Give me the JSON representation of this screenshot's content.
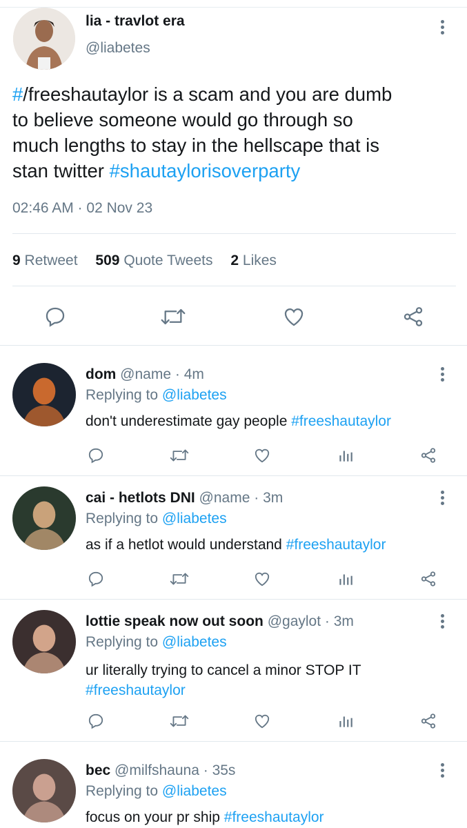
{
  "main_tweet": {
    "display_name": "lia - travlot era",
    "handle": "@liabetes",
    "text_parts": {
      "hash_char": "#",
      "line1_rest": "/freeshautaylor is a scam and you are dumb",
      "line2": "to believe someone would go through so",
      "line3": "much lengths to stay in the hellscape that is",
      "line4_pre": "stan twitter ",
      "line4_tag": "#shautaylorisoverparty"
    },
    "timestamp": "02:46 AM · 02 Nov 23",
    "stats": {
      "retweets_count": "9",
      "retweets_label": "Retweet",
      "quotes_count": "509",
      "quotes_label": "Quote Tweets",
      "likes_count": "2",
      "likes_label": "Likes"
    },
    "actions": [
      "reply-icon",
      "retweet-icon",
      "like-icon",
      "share-icon"
    ]
  },
  "replies": [
    {
      "display_name": "dom",
      "handle": "@name",
      "time": "· 4m",
      "replying_label": "Replying to",
      "replying_handle": "@liabetes",
      "text": "don't underestimate gay people ",
      "tag": "#freeshautaylor",
      "avatar_colors": [
        "#1c2430",
        "#c9692e"
      ]
    },
    {
      "display_name": "cai - hetlots DNI",
      "handle": "@name",
      "time": "· 3m",
      "replying_label": "Replying to",
      "replying_handle": "@liabetes",
      "text": "as if a hetlot would understand ",
      "tag": "#freeshautaylor",
      "avatar_colors": [
        "#2a3a2e",
        "#c9a27a"
      ]
    },
    {
      "display_name": "lottie speak now out soon",
      "handle": "@gaylot",
      "time": "· 3m",
      "replying_label": "Replying to",
      "replying_handle": "@liabetes",
      "text": "ur literally trying to cancel a minor STOP IT",
      "tag": "#freeshautaylor",
      "avatar_colors": [
        "#3b2f2f",
        "#d2a48a"
      ]
    },
    {
      "display_name": "bec",
      "handle": "@milfshauna",
      "time": "· 35s",
      "replying_label": "Replying to",
      "replying_handle": "@liabetes",
      "text": "focus on your pr ship ",
      "tag": "#freeshautaylor",
      "avatar_colors": [
        "#5a4a46",
        "#caa090"
      ]
    }
  ],
  "reply_actions": [
    "reply-icon",
    "retweet-icon",
    "like-icon",
    "analytics-icon",
    "share-icon"
  ],
  "colors": {
    "link": "#1da1f2",
    "grey": "#657786",
    "divider": "#e1e8ed"
  }
}
